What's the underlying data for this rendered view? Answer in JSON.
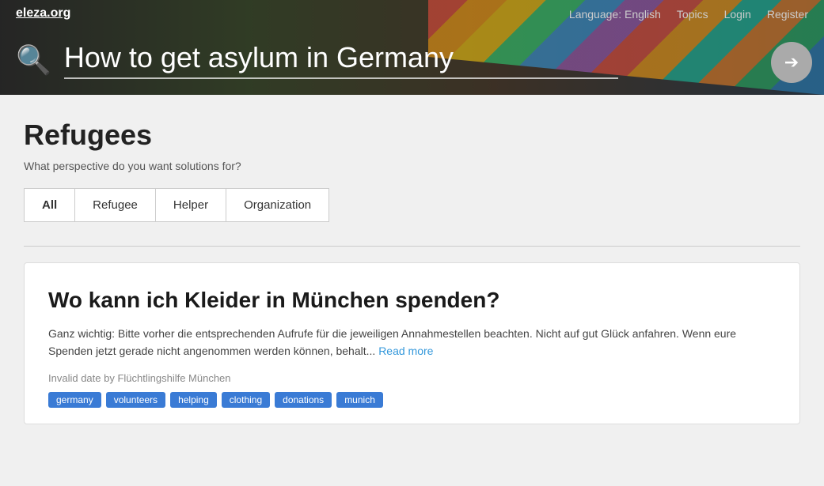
{
  "site": {
    "logo": "eleza.org",
    "nav": {
      "language": "Language: English",
      "topics": "Topics",
      "login": "Login",
      "register": "Register"
    }
  },
  "header": {
    "search_value": "How to get asylum in Germany",
    "search_placeholder": "How to get asylum in Germany",
    "enter_arrow": "➔"
  },
  "main": {
    "page_title": "Refugees",
    "subtitle": "What perspective do you want solutions for?",
    "tabs": [
      {
        "label": "All",
        "active": true
      },
      {
        "label": "Refugee",
        "active": false
      },
      {
        "label": "Helper",
        "active": false
      },
      {
        "label": "Organization",
        "active": false
      }
    ]
  },
  "article": {
    "title": "Wo kann ich Kleider in München spenden?",
    "excerpt": "Ganz wichtig: Bitte vorher die entsprechenden Aufrufe für die jeweiligen Annahmestellen beachten. Nicht auf gut Glück anfahren. Wenn eure Spenden jetzt gerade nicht angenommen werden können, behalt...",
    "read_more": "Read more",
    "meta": "Invalid date by Flüchtlingshilfe München",
    "tags": [
      "germany",
      "volunteers",
      "helping",
      "clothing",
      "donations",
      "munich"
    ]
  }
}
